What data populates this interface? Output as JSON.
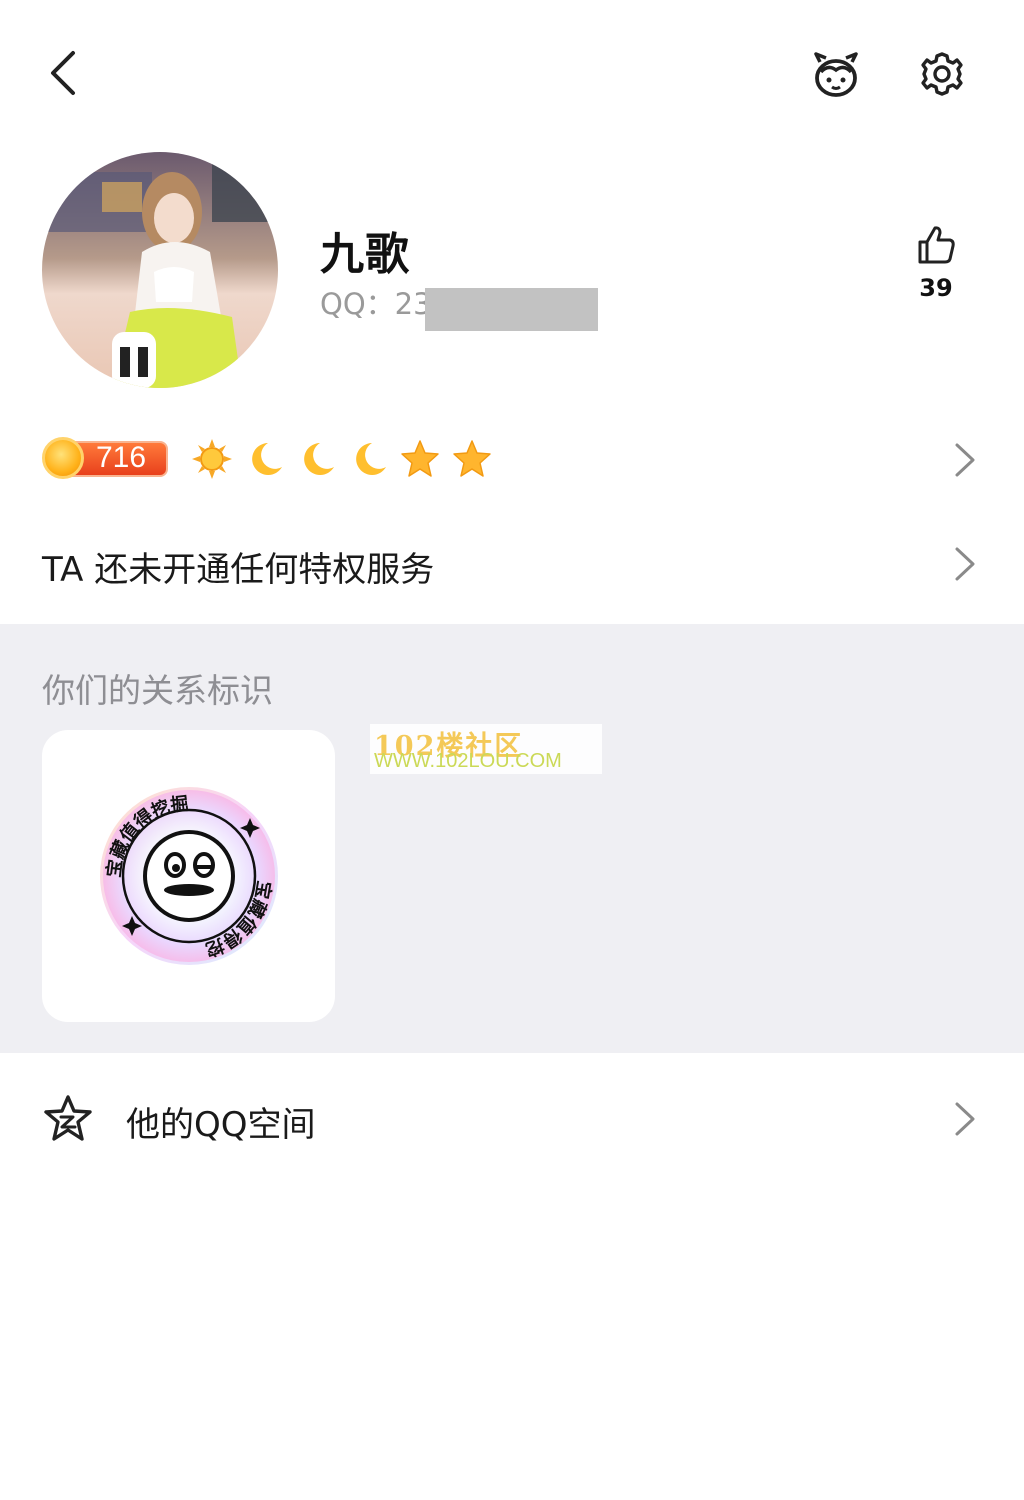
{
  "profile": {
    "nickname": "九歌",
    "qq_label": "QQ：23",
    "likes": "39"
  },
  "level": {
    "coin_count": "716",
    "icons": [
      "sun-icon",
      "moon-icon",
      "moon-icon",
      "moon-icon",
      "star-icon",
      "star-icon"
    ]
  },
  "privilege": {
    "text": "TA 还未开通任何特权服务"
  },
  "relation": {
    "section_title": "你们的关系标识",
    "badge_text": "宝藏值得挖掘",
    "badge_text_2": "宝藏值得挖掘"
  },
  "watermark": {
    "line1": "102楼社区",
    "line2": "WWW.102LOU.COM"
  },
  "zone": {
    "label": "他的QQ空间"
  },
  "colors": {
    "gray_section": "#efeff3",
    "coin_bar": "#e8401c",
    "star": "#ffb52e"
  }
}
